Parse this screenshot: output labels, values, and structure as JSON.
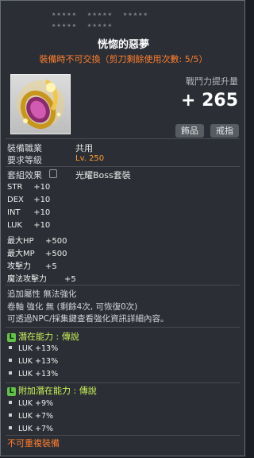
{
  "item": {
    "stars_row1": "★★★★★  ★★★★★  ★★★★★",
    "stars_row2": "★★★★★  ★★★★★",
    "name": "恍惚的惡夢",
    "trade_note": "裝備時不可交換（剪刀剩餘使用次數: 5/5）",
    "combat_power_label": "戰鬥力提升量",
    "combat_power_value": "+ 265",
    "tags": [
      "飾品",
      "戒指"
    ]
  },
  "requirements": {
    "job_label": "裝備職業",
    "job_value": "共用",
    "level_label": "要求等級",
    "level_value": "Lv. 250"
  },
  "set": {
    "label": "套組效果",
    "name": "光耀Boss套裝"
  },
  "stats": [
    {
      "key": "STR",
      "value": "+10"
    },
    {
      "key": "DEX",
      "value": "+10"
    },
    {
      "key": "INT",
      "value": "+10"
    },
    {
      "key": "LUK",
      "value": "+10"
    },
    {
      "key": "最大HP",
      "value": "+500"
    },
    {
      "key": "最大MP",
      "value": "+500"
    },
    {
      "key": "攻擊力",
      "value": "+5"
    },
    {
      "key": "魔法攻擊力",
      "value": "+5"
    }
  ],
  "notes": [
    "追加屬性  無法強化",
    "卷軸 強化 無 (剩餘4次, 可恢復0次)",
    "可透過NPC/採集鍵查看強化資訊詳細內容。"
  ],
  "potential": {
    "title": "潛在能力 : 傳說",
    "badge": "L",
    "lines": [
      "LUK +13%",
      "LUK +13%",
      "LUK +13%"
    ]
  },
  "bonus_potential": {
    "title": "附加潛在能力 : 傳說",
    "badge": "L",
    "lines": [
      "LUK +9%",
      "LUK +7%",
      "LUK +7%"
    ]
  },
  "footer": {
    "warning": "不可重複裝備"
  }
}
